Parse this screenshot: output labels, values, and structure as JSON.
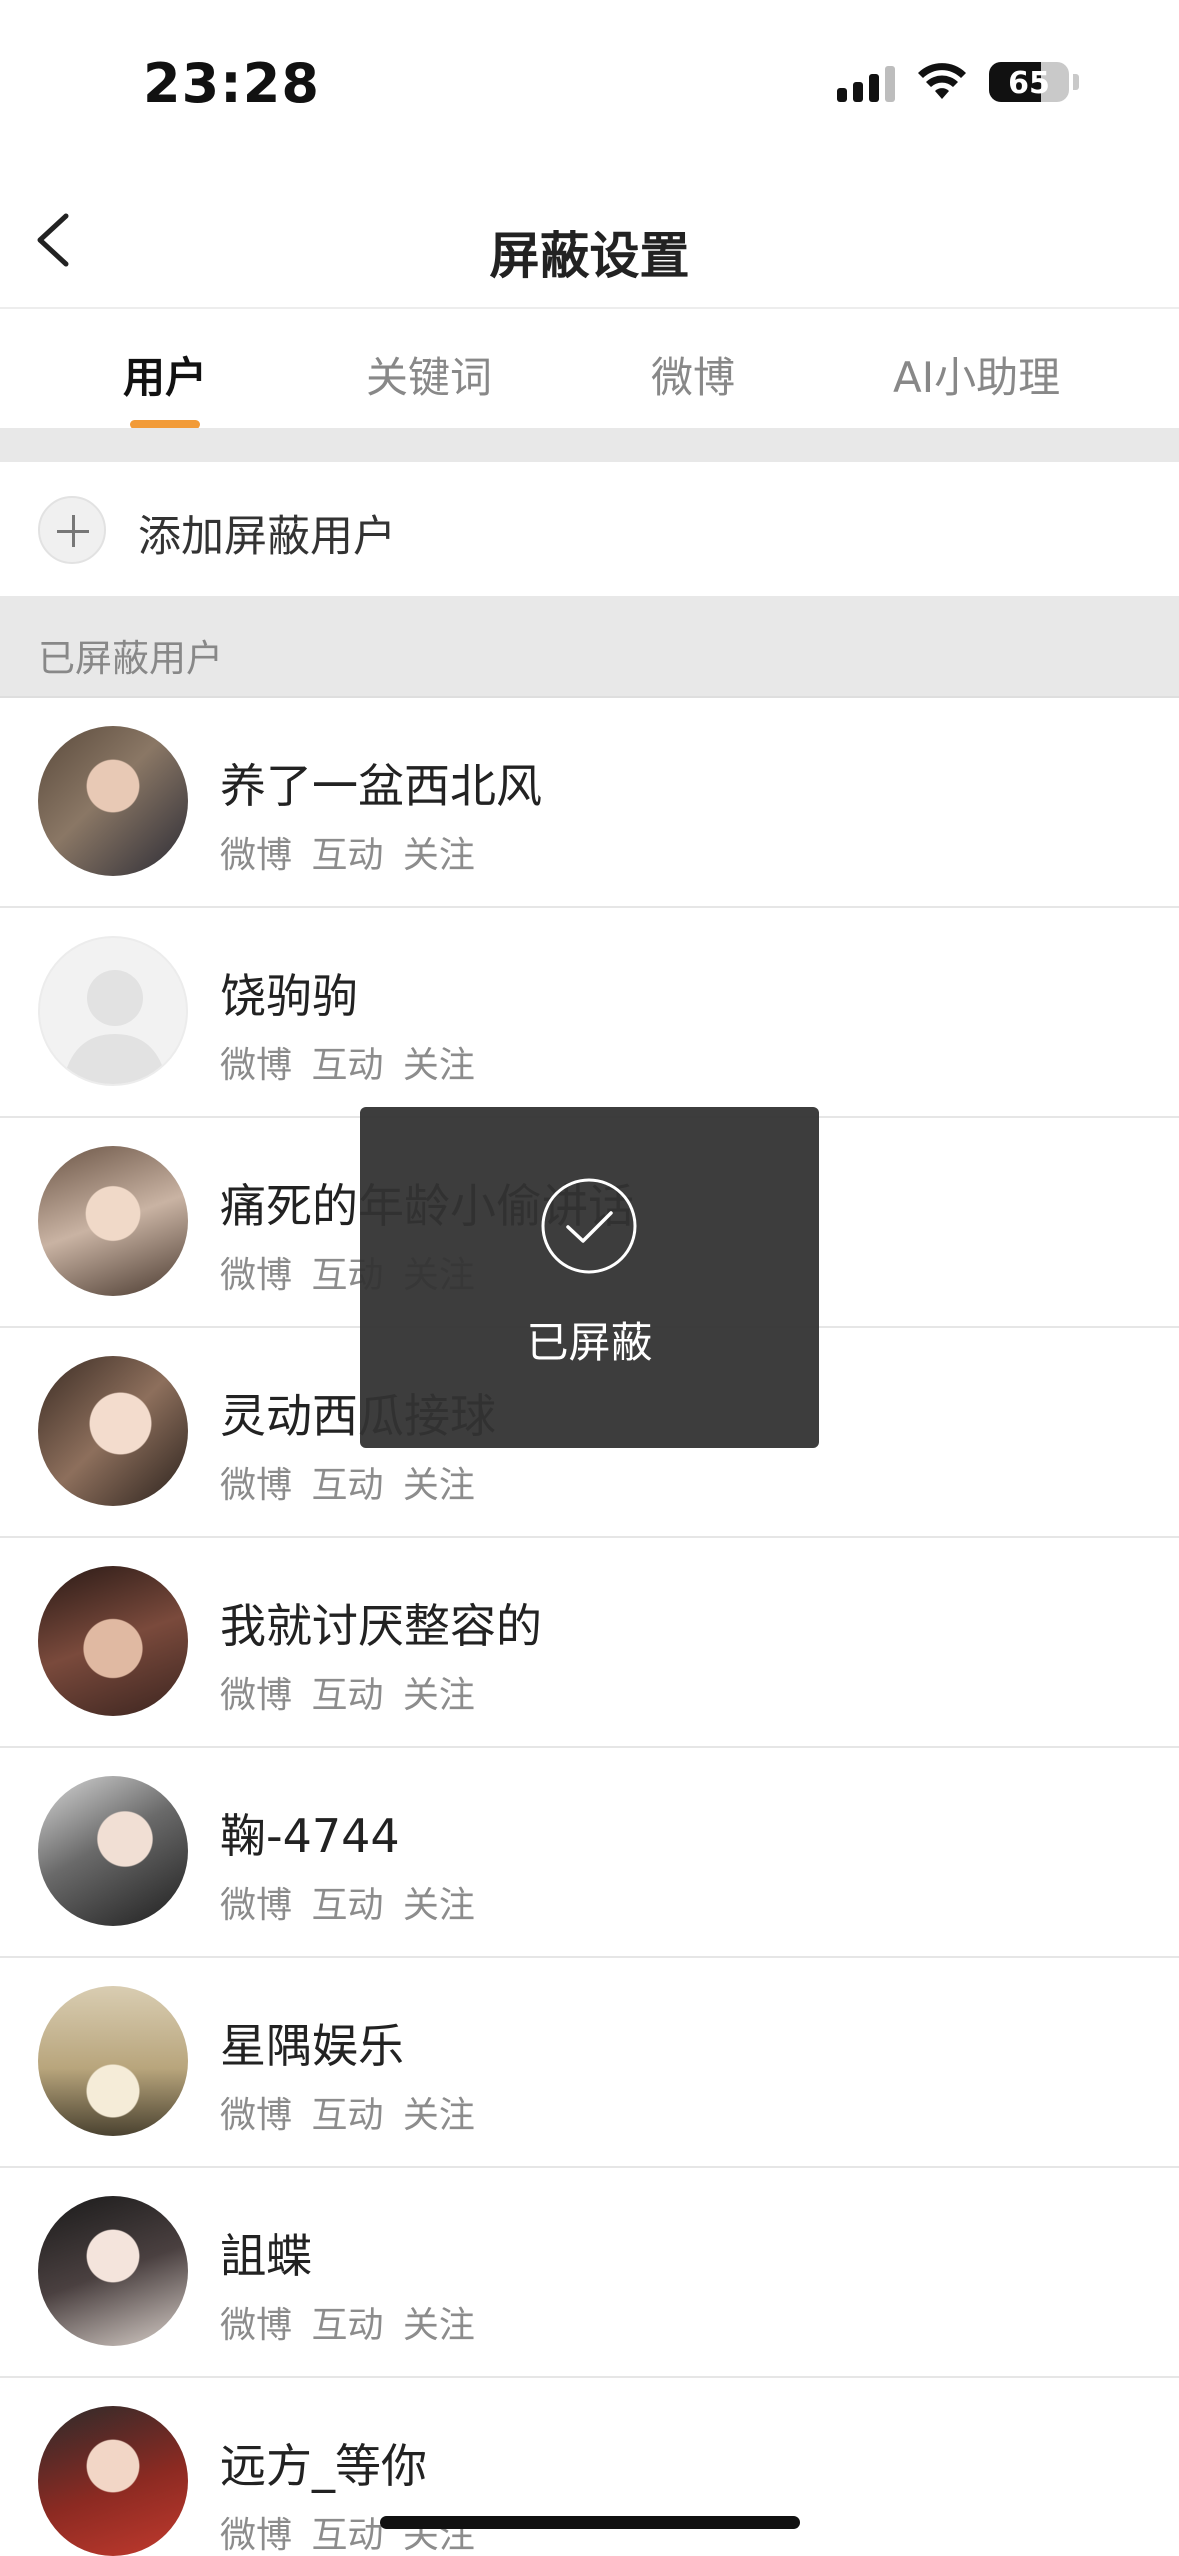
{
  "status_bar": {
    "time": "23:28",
    "battery_level": "65",
    "signal_icon": "signal-icon",
    "wifi_icon": "wifi-icon",
    "battery_icon": "battery-icon"
  },
  "nav": {
    "title": "屏蔽设置",
    "back_icon": "chevron-left-icon"
  },
  "tabs": [
    {
      "label": "用户",
      "active": true
    },
    {
      "label": "关键词",
      "active": false
    },
    {
      "label": "微博",
      "active": false
    },
    {
      "label": "AI小助理",
      "active": false
    }
  ],
  "accent_color": "#f29b38",
  "add_user": {
    "label": "添加屏蔽用户",
    "icon": "plus-icon"
  },
  "section": {
    "title": "已屏蔽用户"
  },
  "users": [
    {
      "name": "养了一盆西北风",
      "meta": "微博 互动 关注"
    },
    {
      "name": "饶驹驹",
      "meta": "微博 互动 关注"
    },
    {
      "name": "痛死的年龄小偷讲话",
      "meta": "微博 互动 关注"
    },
    {
      "name": "灵动西瓜接球",
      "meta": "微博 互动 关注"
    },
    {
      "name": "我就讨厌整容的",
      "meta": "微博 互动 关注"
    },
    {
      "name": "鞠-4744",
      "meta": "微博 互动 关注"
    },
    {
      "name": "星隅娱乐",
      "meta": "微博 互动 关注"
    },
    {
      "name": "詛蝶",
      "meta": "微博 互动 关注"
    },
    {
      "name": "远方_等你",
      "meta": "微博 互动 关注"
    }
  ],
  "toast": {
    "text": "已屏蔽",
    "icon": "check-circle-icon"
  }
}
